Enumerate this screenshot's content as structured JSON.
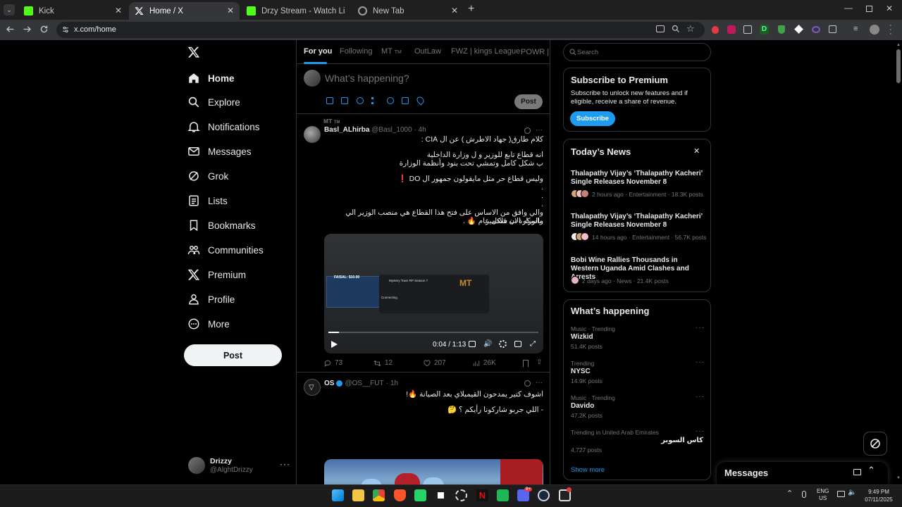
{
  "browser": {
    "tabs": [
      {
        "title": "Kick",
        "favicon_color": "#53fc18",
        "active": false
      },
      {
        "title": "Home / X",
        "favicon_color": "#ffffff",
        "active": true
      },
      {
        "title": "Drzy Stream - Watch Live on Kic",
        "favicon_color": "#53fc18",
        "active": false
      },
      {
        "title": "New Tab",
        "favicon_color": "#9aa0a6",
        "active": false
      }
    ],
    "url": "x.com/home"
  },
  "sidebar": {
    "items": [
      {
        "label": "Home",
        "icon": "home-icon",
        "bold": true
      },
      {
        "label": "Explore",
        "icon": "search-icon"
      },
      {
        "label": "Notifications",
        "icon": "bell-icon"
      },
      {
        "label": "Messages",
        "icon": "envelope-icon"
      },
      {
        "label": "Grok",
        "icon": "grok-icon"
      },
      {
        "label": "Lists",
        "icon": "lists-icon"
      },
      {
        "label": "Bookmarks",
        "icon": "bookmark-icon"
      },
      {
        "label": "Communities",
        "icon": "communities-icon"
      },
      {
        "label": "Premium",
        "icon": "x-icon"
      },
      {
        "label": "Profile",
        "icon": "person-icon"
      },
      {
        "label": "More",
        "icon": "more-circle-icon"
      }
    ],
    "post_label": "Post",
    "account": {
      "name": "Drizzy",
      "handle": "@AlghtDrizzy"
    }
  },
  "feed": {
    "tabs": [
      "For you",
      "Following",
      "MT",
      "OutLaw",
      "FWZ | kings League",
      "POWR | ور"
    ],
    "mt_badge": "TM",
    "composer": {
      "placeholder": "What’s happening?",
      "post_label": "Post"
    },
    "tweets": [
      {
        "community": "MT",
        "community_badge": "TM",
        "name": "Basl_ALhirba",
        "handle": "@Basl_1000",
        "time": "4h",
        "lines": [
          "كلام طارق( جهاد الاطرش ) عن ال CIA :",
          "",
          "انه قطاع تابع للوزير و ل وزارة الداخلية",
          "ب شكل كامل وتمشي تحت بنود وأنظمة الوزارة",
          "",
          "وليس قطاع حر مثل مايقولون جمهور ال DO ❗",
          ".",
          ".",
          ".",
          "والي وافق من الاساس على فتح هذا القطاع هي منصب الوزير  الي ماسكه الان فلادمير",
          "والوزارة ب شكل عام 🔥 ."
        ],
        "video": {
          "time": "0:04 / 1:13",
          "progress": 0.05,
          "inner_price": "FAISAL: $10.00",
          "inner_title": "Mystery Town RP Season 7",
          "inner_status": "Connecting",
          "inner_logo": "MT"
        },
        "stats": {
          "replies": "73",
          "reposts": "12",
          "likes": "207",
          "views": "26K"
        }
      },
      {
        "name": "OS",
        "handle": "@OS__FUT",
        "time": "1h",
        "verified": true,
        "lines": [
          "اشوف كتير يمدحون القيمبلاي بعد الصيانة 🔥!",
          "",
          "- اللي جربو شاركونا رأيكم ؟ 🤔"
        ]
      }
    ]
  },
  "right": {
    "search_placeholder": "Search",
    "premium": {
      "title": "Subscribe to Premium",
      "body": "Subscribe to unlock new features and if eligible, receive a share of revenue.",
      "button": "Subscribe"
    },
    "news": {
      "title": "Today’s News",
      "items": [
        {
          "headline": "Thalapathy Vijay’s ‘Thalapathy Kacheri’ Single Releases November 8",
          "meta": "2 hours ago · Entertainment · 18.3K posts"
        },
        {
          "headline": "Thalapathy Vijay’s ‘Thalapathy Kacheri’ Single Releases November 8",
          "meta": "14 hours ago · Entertainment · 56.7K posts"
        },
        {
          "headline": "Bobi Wine Rallies Thousands in Western Uganda Amid Clashes and Arrests",
          "meta": "2 days ago · News · 21.4K posts"
        }
      ]
    },
    "happening": {
      "title": "What’s happening",
      "trends": [
        {
          "context": "Music · Trending",
          "name": "Wizkid",
          "posts": "51.4K posts"
        },
        {
          "context": "Trending",
          "name": "NYSC",
          "posts": "14.9K posts"
        },
        {
          "context": "Music · Trending",
          "name": "Davido",
          "posts": "47.2K posts"
        },
        {
          "context": "Trending in United Arab Emirates",
          "name": "كاس السوبر",
          "posts": "4,727 posts"
        }
      ],
      "show_more": "Show more"
    },
    "messages_drawer": "Messages"
  },
  "taskbar": {
    "lang": "ENG",
    "region": "US",
    "time": "9:49 PM",
    "date": "07/11/2025",
    "discord_badge": "9+"
  },
  "colors": {
    "accent": "#1d9bf0",
    "border": "#2f3336",
    "muted": "#71767b"
  }
}
